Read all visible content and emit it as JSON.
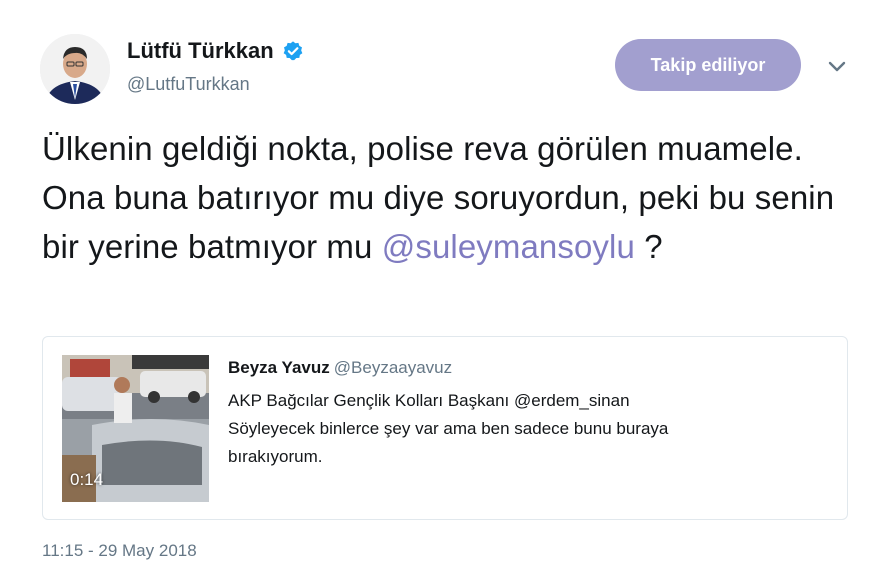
{
  "author": {
    "name": "Lütfü Türkkan",
    "handle": "@LutfuTurkkan",
    "verified_color": "#1da1f2"
  },
  "follow_button": {
    "label": "Takip ediliyor",
    "color": "#a29fcf"
  },
  "tweet": {
    "text_before": "Ülkenin geldiği nokta, polise reva görülen muamele. Ona buna batırıyor mu diye soruyordun, peki bu senin bir yerine batmıyor mu ",
    "mention": "@suleymansoylu",
    "text_after": " ?",
    "mention_color": "#7f7bc0"
  },
  "quoted_tweet": {
    "name": "Beyza Yavuz",
    "handle": "@Beyzaayavuz",
    "text_line1": "AKP Bağcılar Gençlik Kolları Başkanı @erdem_sinan",
    "text_line2": "Söyleyecek binlerce şey var ama ben sadece bunu buraya",
    "text_line3": "bırakıyorum.",
    "video_duration": "0:14"
  },
  "timestamp": "11:15 - 29 May 2018"
}
